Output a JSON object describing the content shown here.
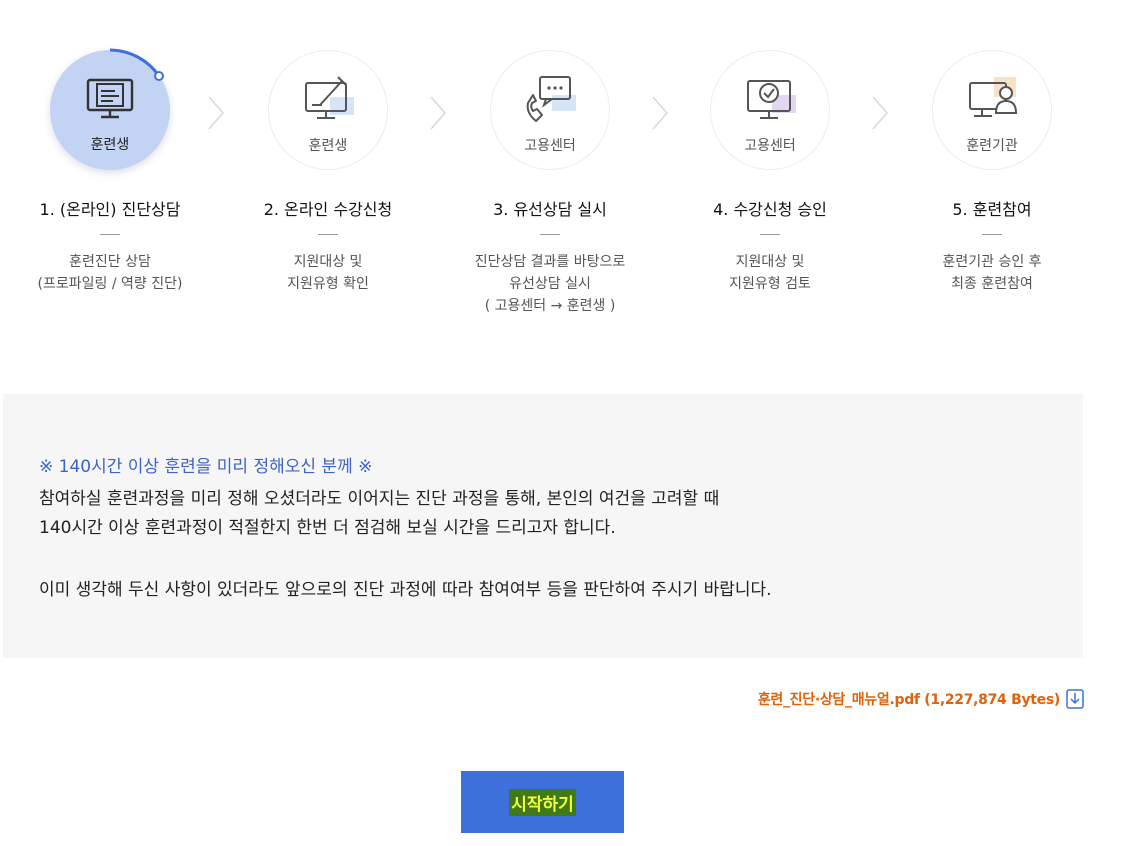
{
  "steps": [
    {
      "icon_label": "훈련생",
      "title": "1. (온라인) 진단상담",
      "desc": "훈련진단 상담\n(프로파일링 / 역량 진단)"
    },
    {
      "icon_label": "훈련생",
      "title": "2. 온라인 수강신청",
      "desc": "지원대상 및\n지원유형 확인"
    },
    {
      "icon_label": "고용센터",
      "title": "3. 유선상담 실시",
      "desc": "진단상담 결과를 바탕으로\n유선상담 실시\n( 고용센터 → 훈련생 )"
    },
    {
      "icon_label": "고용센터",
      "title": "4. 수강신청 승인",
      "desc": "지원대상 및\n지원유형 검토"
    },
    {
      "icon_label": "훈련기관",
      "title": "5. 훈련참여",
      "desc": "훈련기관 승인 후\n최종 훈련참여"
    }
  ],
  "notice": {
    "title": "※ 140시간 이상 훈련을 미리 정해오신 분께 ※",
    "line1": "참여하실 훈련과정을 미리 정해 오셨더라도 이어지는 진단 과정을 통해, 본인의 여건을 고려할 때",
    "line2": "140시간 이상 훈련과정이 적절한지 한번 더 점검해 보실 시간을 드리고자 합니다.",
    "line3": "이미 생각해 두신 사항이 있더라도 앞으로의 진단 과정에 따라 참여여부 등을 판단하여 주시기 바랍니다."
  },
  "download": {
    "label": "훈련_진단·상담_매뉴얼.pdf (1,227,874 Bytes)",
    "icon": "download-icon"
  },
  "start_button": {
    "label": "시작하기"
  },
  "colors": {
    "accent": "#3e70db",
    "notice_title": "#3d63c6",
    "download": "#e0620b",
    "active_step": "#c3d3f3"
  }
}
